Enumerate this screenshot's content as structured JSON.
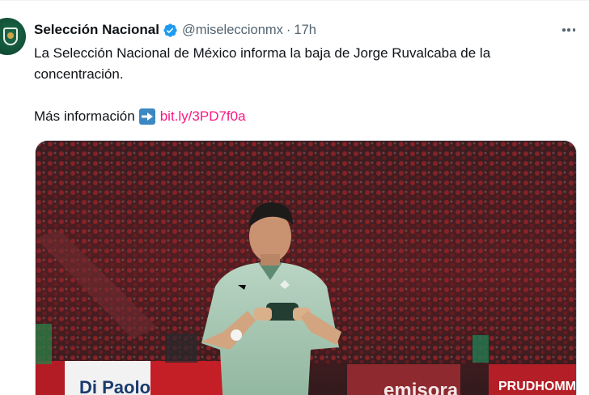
{
  "tweet": {
    "author_name": "Selección Nacional",
    "handle": "@miseleccionmx",
    "separator": "·",
    "time": "17h",
    "text": "La Selección Nacional de México informa la baja de Jorge Ruvalcaba de la concentración.",
    "more_label": "Más información",
    "link": "bit.ly/3PD7f0a",
    "photo_board_texts": [
      "Di Paolo",
      "emisora"
    ],
    "photo_board_right": "PRUDHOMME"
  },
  "icons": {
    "verified": "verified-badge-icon",
    "more": "more-options-icon",
    "arrow": "right-arrow-emoji-icon"
  },
  "colors": {
    "text": "#0f1419",
    "secondary": "#536471",
    "link": "#f91880",
    "verified": "#1d9bf0",
    "emoji_box": "#3b88c3"
  }
}
